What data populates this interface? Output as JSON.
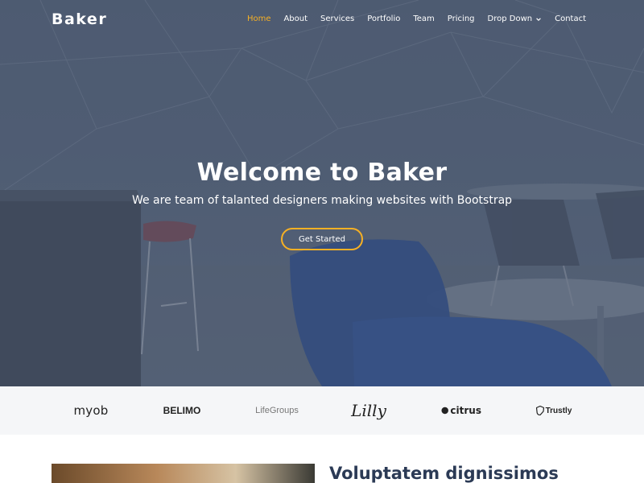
{
  "brand": {
    "name": "Baker"
  },
  "nav": {
    "items": [
      {
        "label": "Home",
        "active": true
      },
      {
        "label": "About"
      },
      {
        "label": "Services"
      },
      {
        "label": "Portfolio"
      },
      {
        "label": "Team"
      },
      {
        "label": "Pricing"
      },
      {
        "label": "Drop Down",
        "icon": "chevron-down-icon"
      },
      {
        "label": "Contact"
      }
    ]
  },
  "hero": {
    "title": "Welcome to Baker",
    "subtitle": "We are team of talanted designers making websites with Bootstrap",
    "cta_label": "Get Started"
  },
  "clients": {
    "logos": [
      "myob",
      "BELIMO",
      "LifeGroups",
      "Lilly",
      "citrus",
      "Trustly"
    ]
  },
  "about": {
    "title": "Voluptatem dignissimos"
  },
  "colors": {
    "accent": "#f6b024",
    "hero_overlay": "#56647b",
    "clients_bg": "#f5f6f8",
    "heading": "#2b3a55"
  }
}
